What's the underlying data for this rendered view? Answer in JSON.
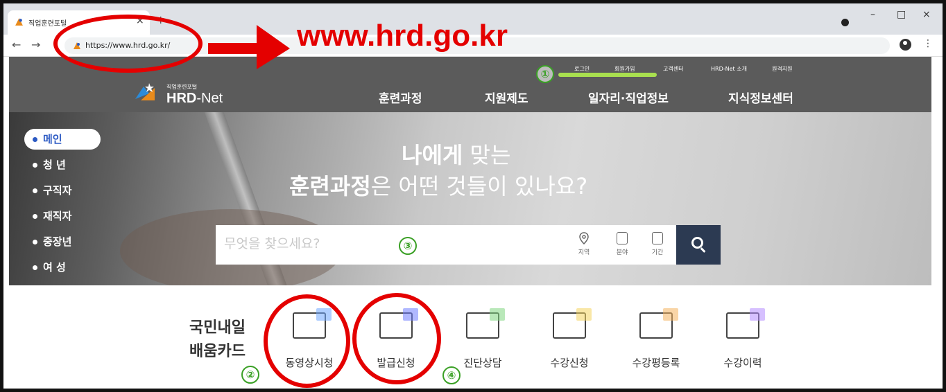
{
  "browser": {
    "tab_title": "직업훈련포털",
    "tab_close": "×",
    "new_tab": "+",
    "url": "https://www.hrd.go.kr/",
    "win_minimize": "–",
    "win_maximize": "□",
    "win_close": "×",
    "back": "←",
    "forward": "→",
    "menu": "⋮"
  },
  "site": {
    "utility_nav": [
      "로그인",
      "회원가입",
      "고객센터",
      "HRD-Net 소개",
      "원격지원"
    ],
    "logo": {
      "sub": "직업훈련포털",
      "main": "HRD",
      "dash": "-Net"
    },
    "gnb": [
      "훈련과정",
      "지원제도",
      "일자리·직업정보",
      "지식정보센터"
    ],
    "side_menu": [
      "메인",
      "청 년",
      "구직자",
      "재직자",
      "중장년",
      "여 성"
    ],
    "headline": {
      "line1_bold": "나에게",
      "line1_rest": " 맞는",
      "line2_bold": "훈련과정",
      "line2_rest": "은 어떤 것들이 있나요?"
    },
    "search": {
      "placeholder": "무엇을 찾으세요?",
      "filters": [
        "지역",
        "분야",
        "기간"
      ]
    },
    "card_section": {
      "title_line1": "국민내일",
      "title_line2": "배움카드",
      "items": [
        "동영상시청",
        "발급신청",
        "진단상담",
        "수강신청",
        "수강평등록",
        "수강이력"
      ]
    }
  },
  "annotations": {
    "url_callout": "www.hrd.go.kr",
    "numbers": [
      "①",
      "②",
      "③",
      "④"
    ],
    "color": "#e40000",
    "number_color": "#3aa025"
  }
}
